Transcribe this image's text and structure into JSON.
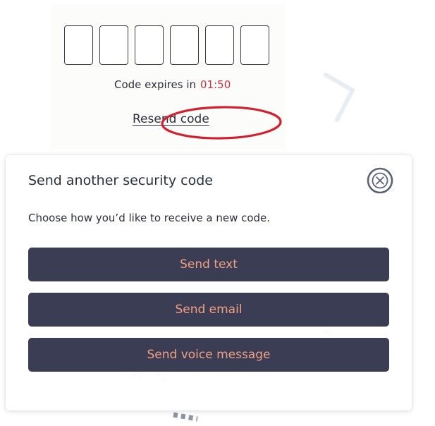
{
  "code_entry": {
    "digits": [
      "",
      "",
      "",
      "",
      "",
      ""
    ],
    "expires_label": "Code expires in",
    "expires_timer": "01:50",
    "resend_label": "Resend code"
  },
  "modal": {
    "title": "Send another security code",
    "subtitle": "Choose how you’d like to receive a new code.",
    "close_icon": "close-circle-icon",
    "options": [
      {
        "label": "Send text"
      },
      {
        "label": "Send email"
      },
      {
        "label": "Send voice message"
      }
    ]
  },
  "colors": {
    "button_bg": "#3a3d53",
    "button_text": "#f0a083",
    "timer": "#d0323b",
    "annotation": "#d2202e",
    "close_icon": "#5a6178"
  }
}
